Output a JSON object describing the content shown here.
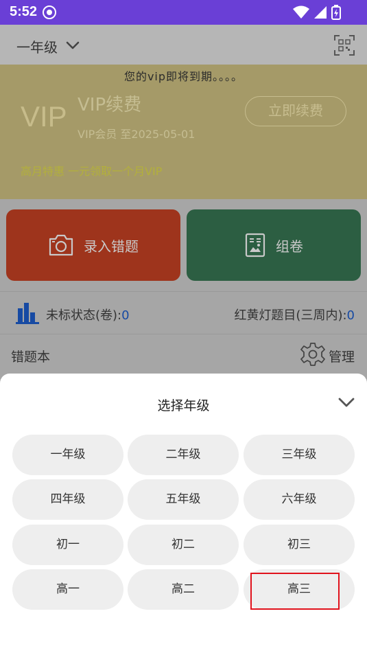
{
  "status_bar": {
    "time": "5:52"
  },
  "header": {
    "grade": "一年级"
  },
  "vip": {
    "notice": "您的vip即将到期。。。。",
    "badge": "VIP",
    "title": "VIP续费",
    "expire": "VIP会员 至2025-05-01",
    "promo": "高月特惠 一元领取一个月VIP",
    "renew_label": "立即续费"
  },
  "actions": {
    "record_label": "录入错题",
    "compose_label": "组卷"
  },
  "stats": {
    "unmarked_label": "未标状态(卷):",
    "unmarked_count": "0",
    "traffic_label": "红黄灯题目(三周内):",
    "traffic_count": "0"
  },
  "wrongbook": {
    "title": "错题本",
    "manage_label": "管理"
  },
  "sheet": {
    "title": "选择年级",
    "grades": [
      "一年级",
      "二年级",
      "三年级",
      "四年级",
      "五年级",
      "六年级",
      "初一",
      "初二",
      "初三",
      "高一",
      "高二",
      "高三"
    ]
  },
  "colors": {
    "status_bar": "#6a3fd6",
    "record_button": "#9e341c",
    "compose_button": "#2c5e42",
    "count_blue": "#174aa3",
    "highlight": "#e0121c"
  }
}
